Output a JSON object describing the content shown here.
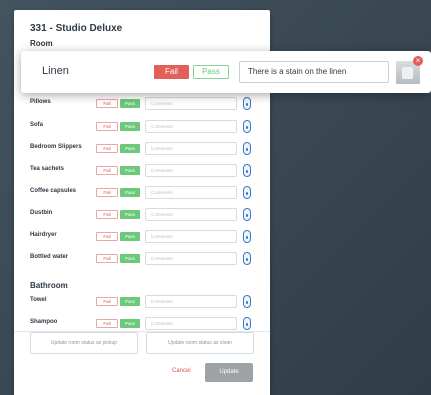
{
  "room": {
    "title": "331 - Studio Deluxe"
  },
  "sections": {
    "room": "Room",
    "bathroom": "Bathroom"
  },
  "buttons": {
    "fail": "Fail",
    "pass": "Pass",
    "comments_placeholder": "Comments"
  },
  "room_items": [
    "Pillows",
    "Sofa",
    "Bedroom Slippers",
    "Tea sachets",
    "Coffee capsules",
    "Dustbin",
    "Hairdryer",
    "Bottled water"
  ],
  "bathroom_items": [
    "Towel",
    "Shampoo"
  ],
  "footer": {
    "pickup_label": "Update room status as pickup",
    "clean_label": "Update room status as clean",
    "cancel_label": "Cancel",
    "update_label": "Update"
  },
  "popup": {
    "item_label": "Linen",
    "fail_label": "Fail",
    "pass_label": "Pass",
    "comment_value": "There is a stain on the linen",
    "photo_icon": "photo-thumbnail",
    "close_icon": "close-icon"
  },
  "colors": {
    "fail": "#e25f5a",
    "pass": "#6cc87a",
    "camera": "#3b78c9",
    "update_disabled": "#9ea3a7"
  }
}
